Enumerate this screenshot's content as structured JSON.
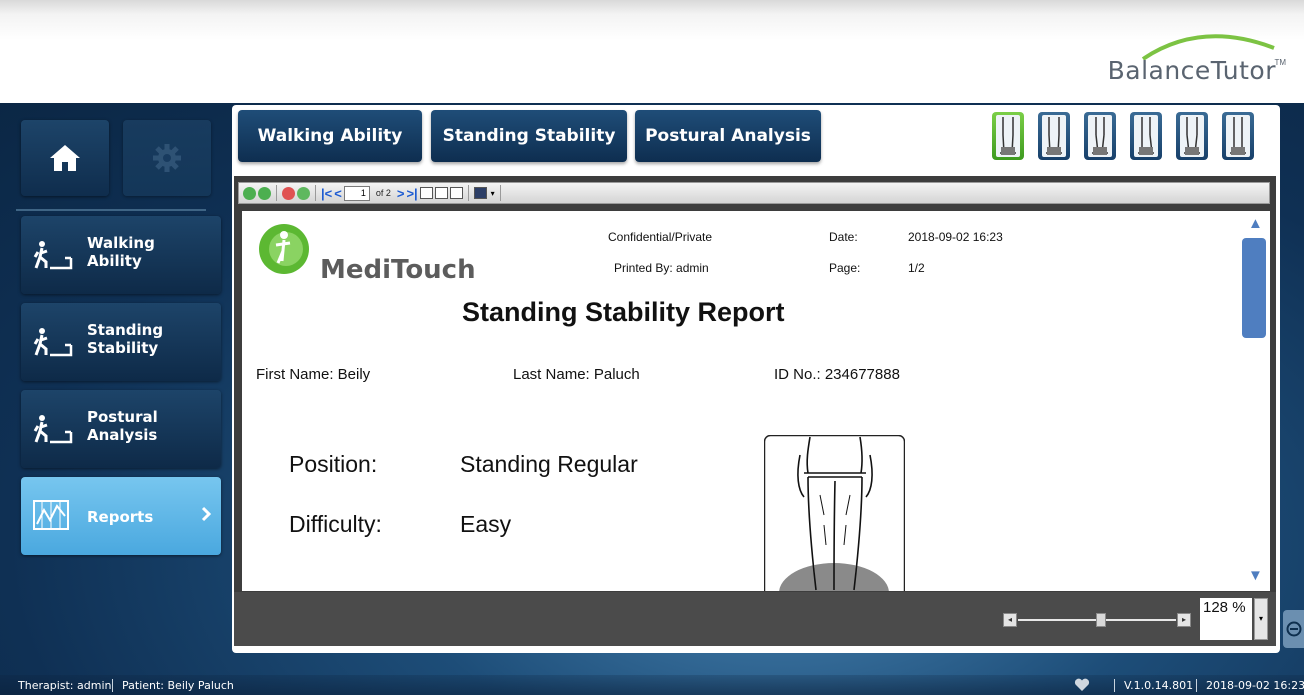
{
  "brand": {
    "name": "BalanceTutor",
    "tm": "TM"
  },
  "sidebar": {
    "home_icon": "home-icon",
    "settings_icon": "gear-icon",
    "items": [
      {
        "label": "Walking Ability",
        "icon": "walking-icon"
      },
      {
        "label": "Standing Stability",
        "icon": "walking-icon"
      },
      {
        "label": "Postural Analysis",
        "icon": "walking-icon"
      },
      {
        "label": "Reports",
        "icon": "chart-icon",
        "active": true
      }
    ]
  },
  "tabs": [
    {
      "label": "Walking Ability"
    },
    {
      "label": "Standing Stability"
    },
    {
      "label": "Postural Analysis"
    }
  ],
  "position_buttons": {
    "count": 6,
    "selected_index": 0,
    "icon": "standing-figure-icon"
  },
  "viewer": {
    "page_input": "1",
    "page_of": "of 2",
    "zoom": "128 %",
    "zoom_level_percent": 128,
    "scroll_up": "▲",
    "scroll_down": "▼"
  },
  "report": {
    "logo": "MediTouch",
    "confidential": "Confidential/Private",
    "printed_by": "Printed By: admin",
    "date_label": "Date:",
    "date_value": "2018-09-02 16:23",
    "page_label": "Page:",
    "page_value": "1/2",
    "title": "Standing Stability Report",
    "first_name": "First Name:  Beily",
    "last_name": "Last Name:  Paluch",
    "id_no": "ID No.: 234677888",
    "position_label": "Position:",
    "position_value": "Standing Regular",
    "difficulty_label": "Difficulty:",
    "difficulty_value": "Easy"
  },
  "status": {
    "therapist": "Therapist: admin",
    "patient": "Patient: Beily Paluch",
    "version": "V.1.0.14.801",
    "datetime": "2018-09-02 16:23"
  },
  "colors": {
    "accent": "#4aa8df",
    "navy": "#0e2e50",
    "green": "#5cb832"
  }
}
